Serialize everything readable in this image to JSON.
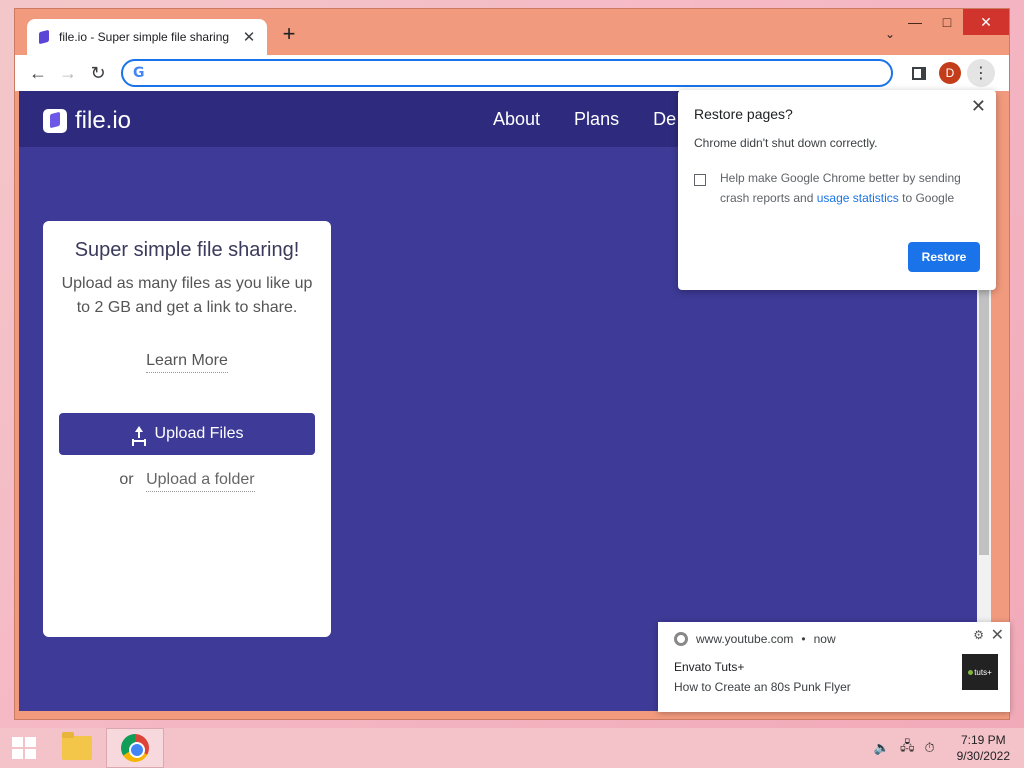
{
  "browser": {
    "tab_title": "file.io - Super simple file sharing",
    "tab_close": "✕",
    "new_tab": "+",
    "tab_search": "⌄",
    "omnibox_value": "",
    "profile_initial": "D"
  },
  "site": {
    "logo_text": "file.io",
    "nav": [
      "About",
      "Plans",
      "De"
    ]
  },
  "card": {
    "title": "Super simple file sharing!",
    "description": "Upload as many files as you like up to 2 GB and get a link to share.",
    "learn_more": "Learn More",
    "upload_button": "Upload Files",
    "or_text": "or",
    "upload_folder": "Upload a folder"
  },
  "restore_popup": {
    "title": "Restore pages?",
    "message": "Chrome didn't shut down correctly.",
    "checkbox_text_1": "Help make Google Chrome better by sending crash reports and",
    "checkbox_link": "usage statistics",
    "checkbox_text_2": "to Google",
    "restore_button": "Restore"
  },
  "notification": {
    "source": "www.youtube.com",
    "separator": "•",
    "time": "now",
    "title": "Envato Tuts+",
    "body": "How to Create an 80s Punk Flyer",
    "thumb_text": "tuts+"
  },
  "taskbar": {
    "time": "7:19 PM",
    "date": "9/30/2022"
  },
  "colors": {
    "page_bg": "#3e3b98",
    "header_bg": "#2e2b7e",
    "accent_blue": "#1a73e8",
    "window_frame": "#f29a7e"
  }
}
